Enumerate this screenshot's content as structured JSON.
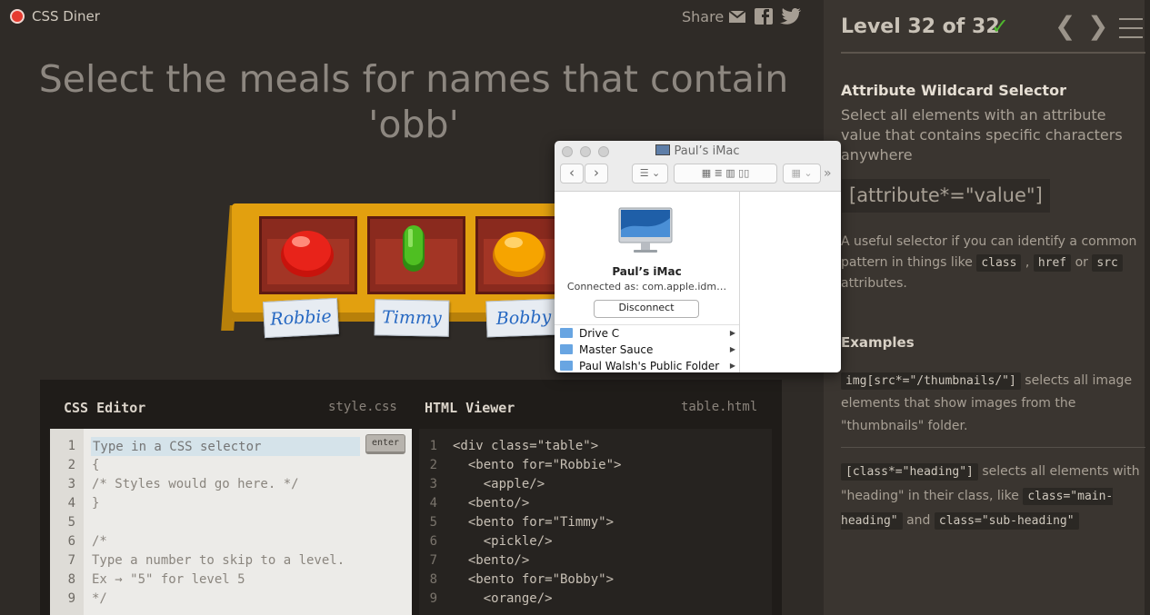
{
  "app": {
    "name": "CSS Diner",
    "share_label": "Share"
  },
  "level": {
    "instruction": "Select the meals for names that contain 'obb'",
    "progress": "Level 32 of 32"
  },
  "table": {
    "names": [
      "Robbie",
      "Timmy",
      "Bobby"
    ],
    "foods": [
      "apple",
      "pickle",
      "orange"
    ]
  },
  "editor": {
    "css_title": "CSS Editor",
    "css_file": "style.css",
    "placeholder": "Type in a CSS selector",
    "enter_label": "enter",
    "css_lines": [
      "",
      "{",
      "/* Styles would go here. */",
      "}",
      "",
      "/*",
      "Type a number to skip to a level.",
      "Ex → \"5\" for level 5",
      "*/"
    ],
    "html_title": "HTML Viewer",
    "html_file": "table.html",
    "html_lines": [
      "<div class=\"table\">",
      "  <bento for=\"Robbie\">",
      "    <apple/>",
      "  <bento/>",
      "  <bento for=\"Timmy\">",
      "    <pickle/>",
      "  <bento/>",
      "  <bento for=\"Bobby\">",
      "    <orange/>"
    ],
    "line_numbers": [
      "1",
      "2",
      "3",
      "4",
      "5",
      "6",
      "7",
      "8",
      "9"
    ]
  },
  "sidebar": {
    "title": "Attribute Wildcard Selector",
    "subtitle": "Select all elements with an attribute value that contains specific characters anywhere",
    "syntax": "[attribute*=\"value\"]",
    "desc_pre": "A useful selector if you can identify a common pattern in things like",
    "kw_class": "class",
    "kw_href": "href",
    "kw_or": "or",
    "kw_src": "src",
    "desc_post": "attributes.",
    "examples_title": "Examples",
    "ex1_code": "img[src*=\"/thumbnails/\"]",
    "ex1_text": "selects all image elements that show images from the \"thumbnails\" folder.",
    "ex2_code": "[class*=\"heading\"]",
    "ex2_text": "selects all elements with \"heading\" in their class, like",
    "ex2_kw1": "class=\"main-heading\"",
    "ex2_and": "and",
    "ex2_kw2": "class=\"sub-heading\""
  },
  "finder": {
    "title": "Paul’s iMac",
    "device_name": "Paul’s iMac",
    "connected_as": "Connected as: com.apple.idm…",
    "disconnect_label": "Disconnect",
    "shares": [
      "Drive C",
      "Master Sauce",
      "Paul Walsh's Public Folder"
    ]
  },
  "colors": {
    "accent": "#4fb72e",
    "background": "#2f2b27",
    "sidebar": "#3a3530"
  }
}
